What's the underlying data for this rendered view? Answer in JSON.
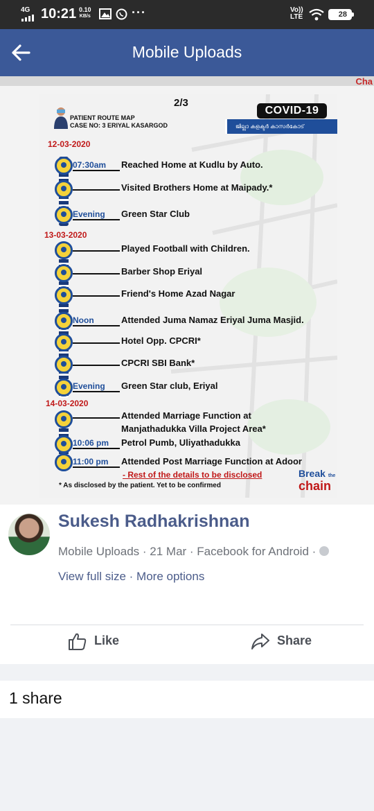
{
  "status_bar": {
    "network": "4G",
    "time": "10:21",
    "speed_value": "0.10",
    "speed_unit": "KB/s",
    "dots": "···",
    "volte": "Vo))",
    "lte": "LTE",
    "battery": "28"
  },
  "app_bar": {
    "title": "Mobile Uploads"
  },
  "background": {
    "chain_fragment": "Cha"
  },
  "poster": {
    "page": "2/3",
    "header_line1": "PATIENT ROUTE MAP",
    "header_line2": "CASE NO: 3  ERIYAL KASARGOD",
    "badge": "COVID-19",
    "department": "ജില്ലാ കളക്ടർ കാസർകോട്",
    "dates": [
      "12-03-2020",
      "13-03-2020",
      "14-03-2020"
    ],
    "entries": [
      {
        "time": "07:30am",
        "text": "Reached Home at Kudlu by Auto."
      },
      {
        "time": "",
        "text": "Visited Brothers Home at Maipady.*"
      },
      {
        "time": "Evening",
        "text": "Green Star Club"
      },
      {
        "time": "",
        "text": "Played Football with Children."
      },
      {
        "time": "",
        "text": "Barber Shop Eriyal"
      },
      {
        "time": "",
        "text": "Friend's Home Azad Nagar"
      },
      {
        "time": "Noon",
        "text": "Attended Juma Namaz Eriyal Juma Masjid."
      },
      {
        "time": "",
        "text": "Hotel Opp. CPCRI*"
      },
      {
        "time": "",
        "text": "CPCRI SBI Bank*"
      },
      {
        "time": "Evening",
        "text": "Green Star club, Eriyal"
      },
      {
        "time": "",
        "text": "Attended Marriage Function at"
      },
      {
        "time": "10:06 pm",
        "text": "Petrol Pumb, Uliyathadukka"
      },
      {
        "time": "11:00 pm",
        "text": "Attended Post Marriage Function at Adoor"
      }
    ],
    "entry_continuation": "Manjathadukka Villa Project Area*",
    "rest_note": "- Rest of the details to be disclosed",
    "footnote": "* As disclosed by the patient. Yet to be confirmed",
    "break_word": "Break",
    "the_word": "the",
    "chain_word": "chain"
  },
  "post": {
    "author": "Sukesh Radhakrishnan",
    "meta": "Mobile Uploads · 21 Mar · Facebook for Android ·",
    "links": "View full size · More options",
    "like_label": "Like",
    "share_label": "Share"
  },
  "share_count": "1 share"
}
